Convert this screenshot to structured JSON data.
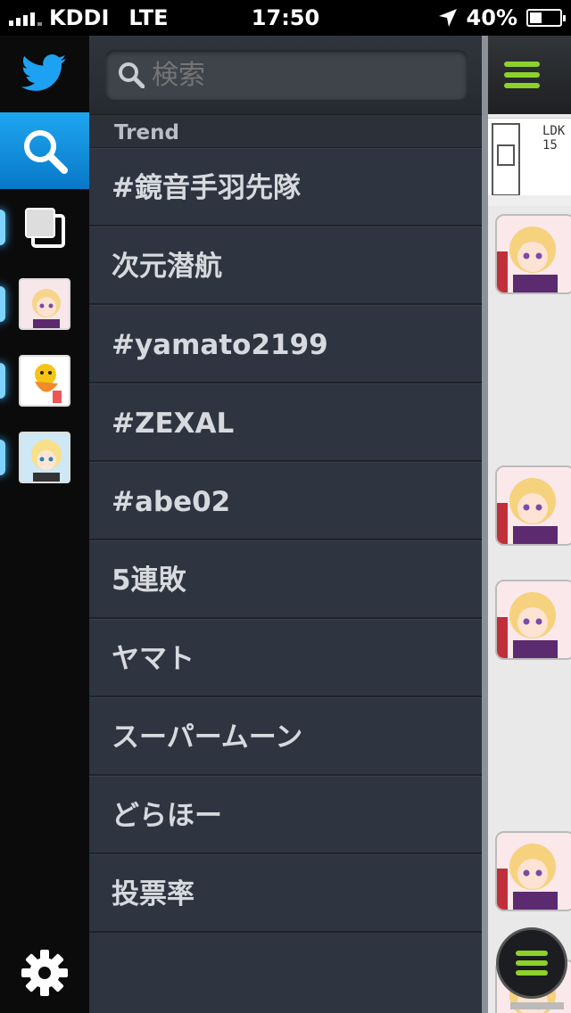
{
  "status_bar": {
    "carrier": "KDDI",
    "network": "LTE",
    "time": "17:50",
    "battery": "40%",
    "battery_level": 0.4
  },
  "search": {
    "placeholder": "検索"
  },
  "trend": {
    "header": "Trend",
    "items": [
      "#鏡音手羽先隊",
      "次元潜航",
      "#yamato2199",
      "#ZEXAL",
      "#abe02",
      "5連敗",
      "ヤマト",
      "スーパームーン",
      "どらほー",
      "投票率"
    ]
  },
  "timeline": {
    "thumb_text": "LDK\n15"
  },
  "icons": [
    "twitter-bird-icon",
    "search-icon",
    "lists-icon",
    "gear-icon",
    "menu-icon"
  ],
  "colors": {
    "accent": "#1a9ff0",
    "menu_green": "#8dd12b",
    "panel": "#2e3440"
  }
}
